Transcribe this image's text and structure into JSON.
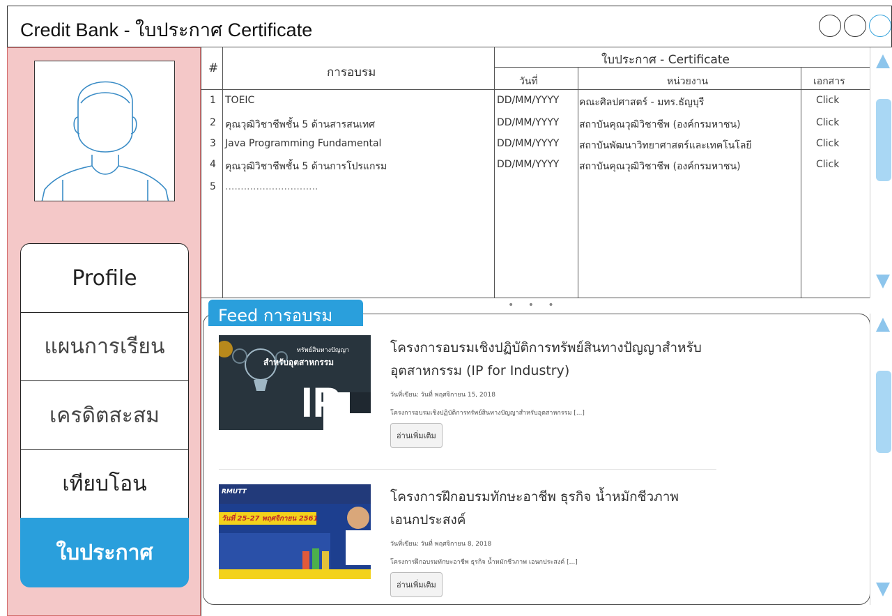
{
  "window": {
    "title": "Credit Bank - ใบประกาศ Certificate"
  },
  "sidebar": {
    "items": [
      {
        "label": "Profile"
      },
      {
        "label": "แผนการเรียน"
      },
      {
        "label": "เครดิตสะสม"
      },
      {
        "label": "เทียบโอน"
      },
      {
        "label": "ใบประกาศ"
      }
    ]
  },
  "table": {
    "headers": {
      "num": "#",
      "course": "การอบรม",
      "certificate": "ใบประกาศ - Certificate",
      "date": "วันที่",
      "org": "หน่วยงาน",
      "doc": "เอกสาร"
    },
    "rows": [
      {
        "num": "1",
        "course": "TOEIC",
        "date": "DD/MM/YYYY",
        "org": "คณะศิลปศาสตร์ - มทร.ธัญบุรี",
        "doc": "Click"
      },
      {
        "num": "2",
        "course": "คุณวุฒิวิชาชีพชั้น 5 ด้านสารสนเทศ",
        "date": "DD/MM/YYYY",
        "org": "สถาบันคุณวุฒิวิชาชีพ (องค์กรมหาชน)",
        "doc": "Click"
      },
      {
        "num": "3",
        "course": "Java Programming Fundamental",
        "date": "DD/MM/YYYY",
        "org": "สถาบันพัฒนาวิทยาศาสตร์และเทคโนโลยี",
        "doc": "Click"
      },
      {
        "num": "4",
        "course": "คุณวุฒิวิชาชีพชั้น 5 ด้านการโปรแกรม",
        "date": "DD/MM/YYYY",
        "org": "สถาบันคุณวุฒิวิชาชีพ (องค์กรมหาชน)",
        "doc": "Click"
      },
      {
        "num": "5",
        "course": "..............................",
        "date": "",
        "org": "",
        "doc": ""
      }
    ]
  },
  "feed": {
    "tab_label": "Feed การอบรม",
    "posts": [
      {
        "title": "โครงการอบรมเชิงปฏิบัติการทรัพย์สินทางปัญญาสำหรับอุตสาหกรรม (IP for Industry)",
        "date": "วันที่เขียน: วันที่ พฤศจิกายน 15, 2018",
        "excerpt": "โครงการอบรมเชิงปฏิบัติการทรัพย์สินทางปัญญาสำหรับอุตสาหกรรม [...]",
        "read_more": "อ่านเพิ่มเติม",
        "thumb_text_1": "ทรัพย์สินทางปัญญา",
        "thumb_text_2": "สำหรับอุตสาหกรรม",
        "thumb_big": "IP"
      },
      {
        "title": "โครงการฝึกอบรมทักษะอาชีพ ธุรกิจ น้ำหมักชีวภาพ เอนกประสงค์",
        "date": "วันที่เขียน: วันที่ พฤศจิกายน 8, 2018",
        "excerpt": "โครงการฝึกอบรมทักษะอาชีพ ธุรกิจ น้ำหมักชีวภาพ เอนกประสงค์ [...]",
        "read_more": "อ่านเพิ่มเติม",
        "thumb_text_1": "RMUTT",
        "thumb_text_2": "วันที่ 25-27 พฤศจิกายน 2561"
      }
    ]
  },
  "colors": {
    "accent": "#2a9fdc",
    "sidebar_bg": "#f4c8c8",
    "scroll": "#8dc5ec"
  }
}
